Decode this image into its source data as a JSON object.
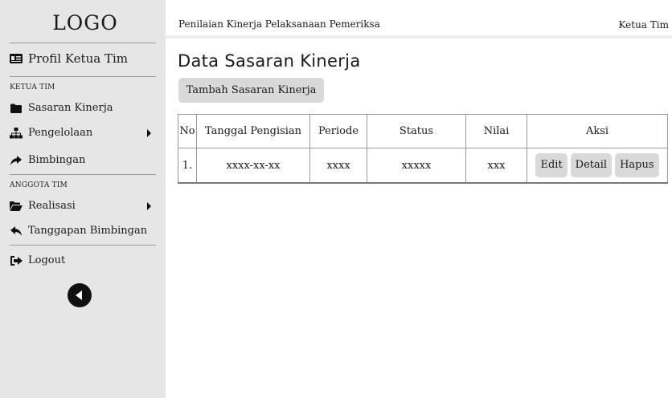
{
  "sidebar": {
    "logo": "LOGO",
    "profile_label": "Profil Ketua Tim",
    "section_ketua": "KETUA TIM",
    "items_ketua": [
      {
        "label": "Sasaran Kinerja",
        "icon": "folder-icon"
      },
      {
        "label": "Pengelolaan",
        "icon": "sitemap-icon",
        "has_submenu": true
      },
      {
        "label": "Bimbingan",
        "icon": "share-arrow-icon"
      }
    ],
    "section_anggota": "ANGGOTA TIM",
    "items_anggota": [
      {
        "label": "Realisasi",
        "icon": "folder-open-icon",
        "has_submenu": true
      },
      {
        "label": "Tanggapan Bimbingan",
        "icon": "reply-icon"
      }
    ],
    "logout_label": "Logout"
  },
  "header": {
    "title": "Penilaian Kinerja Pelaksanaan Pemeriksa",
    "role": "Ketua Tim"
  },
  "main": {
    "page_title": "Data Sasaran Kinerja",
    "add_button": "Tambah Sasaran Kinerja",
    "table": {
      "columns": [
        "No",
        "Tanggal Pengisian",
        "Periode",
        "Status",
        "Nilai",
        "Aksi"
      ],
      "rows": [
        {
          "no": "1.",
          "tanggal": "xxxx-xx-xx",
          "periode": "xxxx",
          "status": "xxxxx",
          "nilai": "xxx",
          "actions": [
            "Edit",
            "Detail",
            "Hapus"
          ]
        }
      ]
    }
  }
}
